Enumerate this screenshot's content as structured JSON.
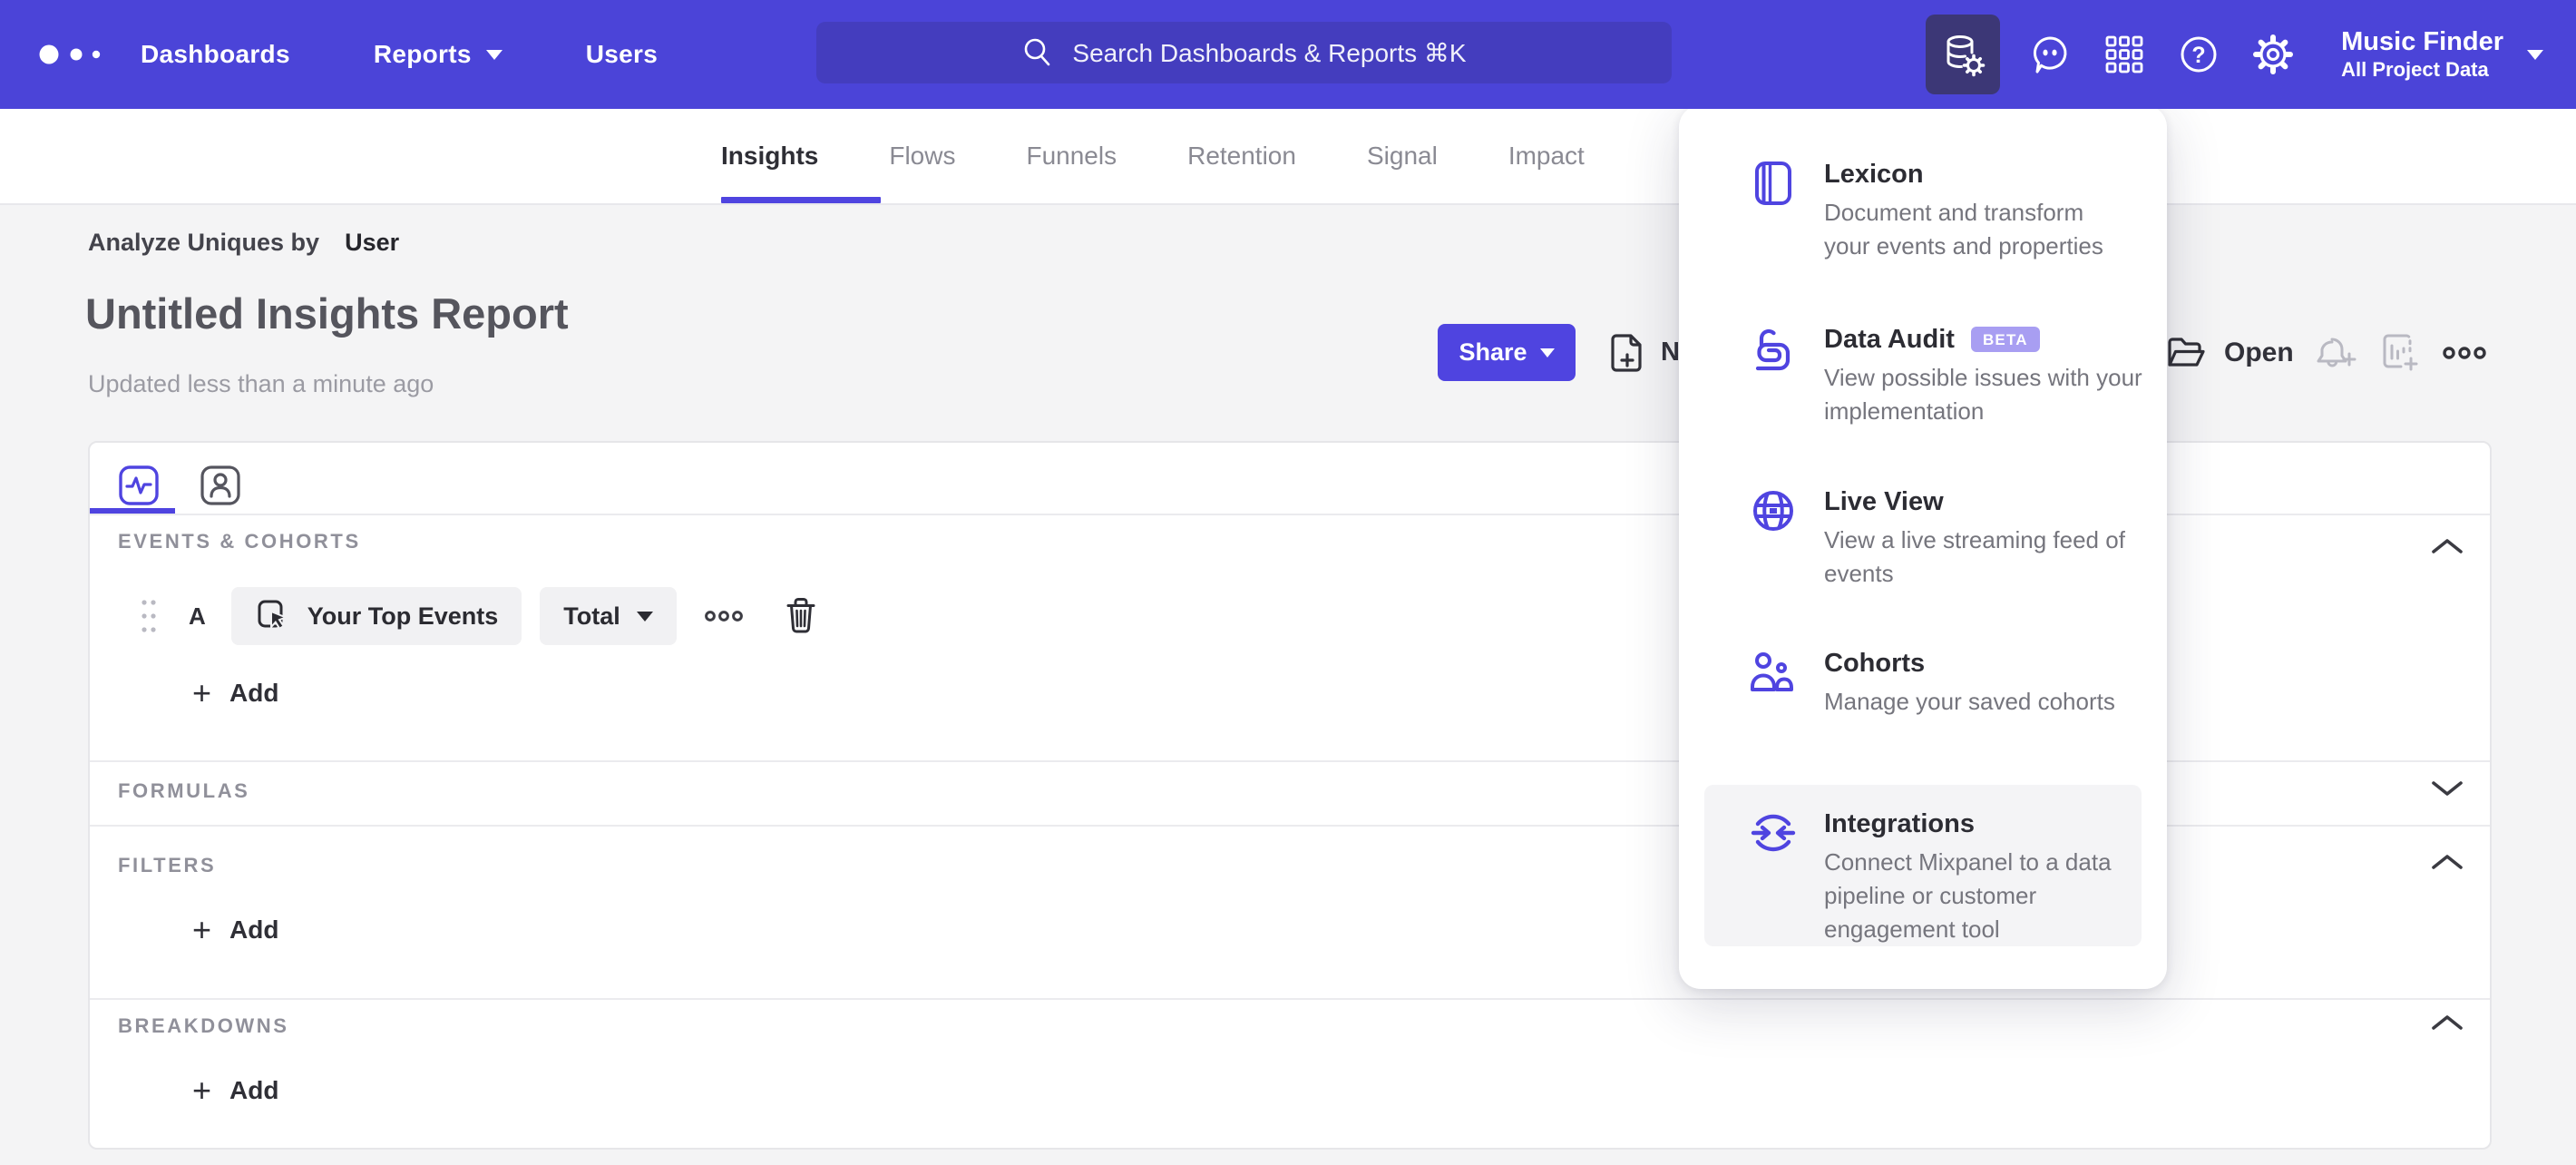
{
  "navbar": {
    "items": [
      {
        "label": "Dashboards"
      },
      {
        "label": "Reports"
      },
      {
        "label": "Users"
      }
    ],
    "search_placeholder": "Search Dashboards & Reports ⌘K",
    "project": {
      "name": "Music Finder",
      "scope": "All Project Data"
    }
  },
  "tabs": [
    {
      "label": "Insights"
    },
    {
      "label": "Flows"
    },
    {
      "label": "Funnels"
    },
    {
      "label": "Retention"
    },
    {
      "label": "Signal"
    },
    {
      "label": "Impact"
    }
  ],
  "report_header": {
    "analyze_label": "Analyze Uniques by",
    "analyze_value": "User",
    "title": "Untitled Insights Report",
    "updated": "Updated less than a minute ago",
    "share_label": "Share",
    "new_label": "New",
    "open_label": "Open"
  },
  "builder": {
    "events": {
      "label": "EVENTS & COHORTS",
      "row_letter": "A",
      "event_name": "Your Top Events",
      "metric": "Total",
      "add_label": "Add"
    },
    "formulas": {
      "label": "FORMULAS"
    },
    "filters": {
      "label": "FILTERS",
      "add_label": "Add"
    },
    "breakdowns": {
      "label": "BREAKDOWNS",
      "add_label": "Add"
    }
  },
  "menu": {
    "items": [
      {
        "title": "Lexicon",
        "description": "Document and transform your events and properties"
      },
      {
        "title": "Data Audit",
        "badge": "BETA",
        "description": "View possible issues with your implementation"
      },
      {
        "title": "Live View",
        "description": "View a live streaming feed of events"
      },
      {
        "title": "Cohorts",
        "description": "Manage your saved cohorts"
      },
      {
        "title": "Integrations",
        "description": "Connect Mixpanel to a data pipeline or customer engagement tool"
      }
    ]
  },
  "icons": {
    "mixpanel-logo": "three-dots",
    "search-icon": "magnifier",
    "data-management-icon": "database-gear",
    "feedback-icon": "speech-bubble",
    "apps-grid-icon": "nine-squares",
    "help-icon": "question-circle",
    "settings-gear-icon": "gear",
    "insights-tab-icon": "pulse-square",
    "users-tab-icon": "person-square",
    "drag-handle-icon": "six-dots",
    "event-icon": "cursor-click",
    "ellipsis-icon": "three-circles",
    "trash-icon": "trash-can",
    "new-report-icon": "document-plus",
    "folder-open-icon": "open-folder",
    "bell-plus-icon": "bell-plus",
    "chart-add-icon": "chart-plus",
    "lexicon-icon": "book",
    "data-audit-icon": "lock-spiral",
    "live-view-icon": "globe",
    "cohorts-icon": "two-people",
    "integrations-icon": "arrows-circle"
  },
  "colors": {
    "navbar": "#4b44d8",
    "accent": "#4f44e0",
    "search_bg": "#443dbe",
    "active_icon_bg": "#3c3776",
    "page_bg": "#f4f4f5",
    "beta_badge": "#a89ef2"
  }
}
